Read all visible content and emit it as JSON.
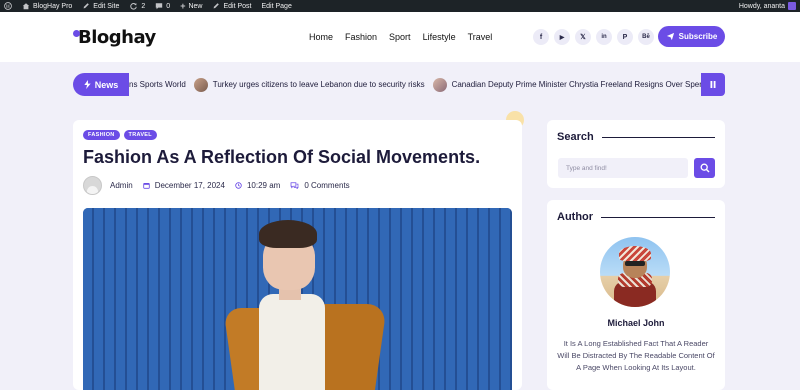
{
  "admin_bar": {
    "site_name": "BlogHay Pro",
    "edit_site": "Edit Site",
    "updates_count": "2",
    "comments_count": "0",
    "new_label": "New",
    "edit_post": "Edit Post",
    "edit_page": "Edit Page",
    "greeting": "Howdy, ananta"
  },
  "header": {
    "logo_text": "Bloghay",
    "nav": [
      "Home",
      "Fashion",
      "Sport",
      "Lifestyle",
      "Travel"
    ],
    "socials": [
      {
        "icon": "facebook-icon",
        "glyph": "f"
      },
      {
        "icon": "youtube-icon",
        "glyph": "▶"
      },
      {
        "icon": "x-icon",
        "glyph": "𝕏"
      },
      {
        "icon": "linkedin-icon",
        "glyph": "in"
      },
      {
        "icon": "pinterest-icon",
        "glyph": "P"
      },
      {
        "icon": "behance-icon",
        "glyph": "Bē"
      }
    ],
    "subscribe_label": "Subscribe"
  },
  "ticker": {
    "label": "News",
    "items": [
      "ns Sports World",
      "Turkey urges citizens to leave Lebanon due to security risks",
      "Canadian Deputy Prime Minister Chrystia Freeland Resigns Over Spend"
    ]
  },
  "article": {
    "tags": [
      "FASHION",
      "TRAVEL"
    ],
    "title": "Fashion As A Reflection Of Social Movements.",
    "author": "Admin",
    "date": "December 17, 2024",
    "time": "10:29 am",
    "comments": "0 Comments"
  },
  "sidebar": {
    "search": {
      "title": "Search",
      "placeholder": "Type and find!"
    },
    "author": {
      "title": "Author",
      "name": "Michael John",
      "bio": "It Is A Long Established Fact That A Reader Will Be Distracted By The Readable Content Of A Page When Looking At Its Layout."
    }
  },
  "colors": {
    "accent": "#6b4ce6",
    "admin_bar": "#1d2327",
    "page_bg": "#f1f0f9",
    "text": "#1d1b3a"
  }
}
